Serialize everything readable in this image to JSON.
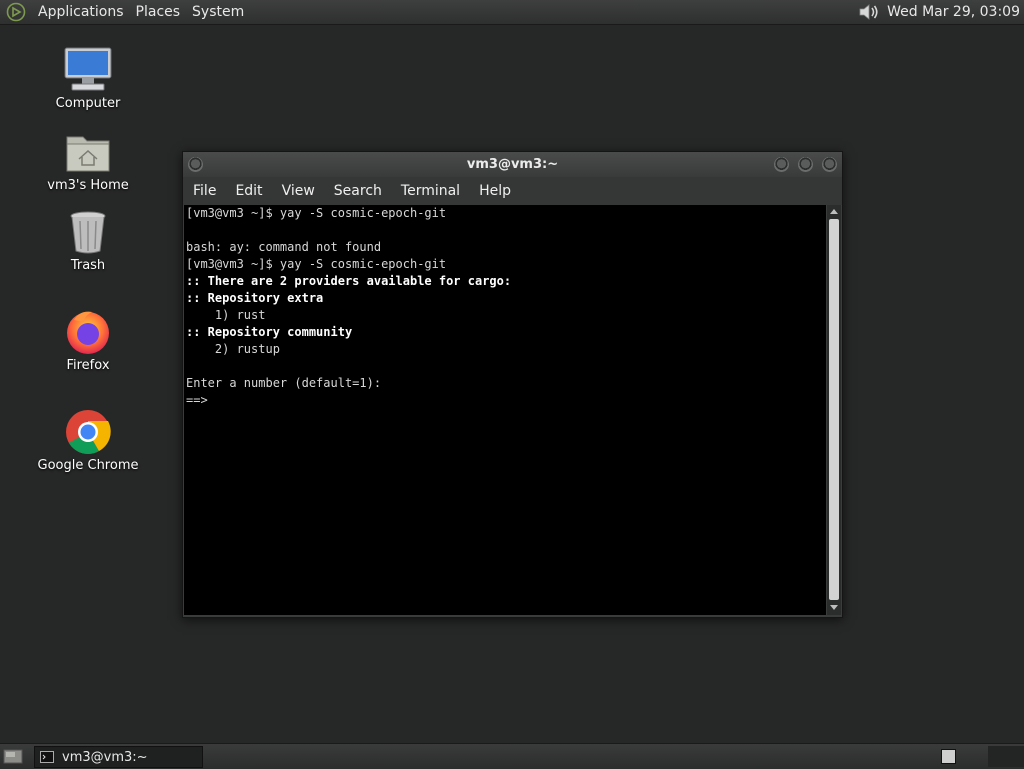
{
  "top_panel": {
    "menus": [
      "Applications",
      "Places",
      "System"
    ],
    "clock": "Wed Mar 29, 03:09",
    "icons": {
      "logo": "distro-logo-icon",
      "volume": "volume-icon"
    }
  },
  "desktop_icons": [
    {
      "label": "Computer",
      "icon": "computer-icon"
    },
    {
      "label": "vm3's Home",
      "icon": "home-folder-icon"
    },
    {
      "label": "Trash",
      "icon": "trash-icon"
    },
    {
      "label": "Firefox",
      "icon": "firefox-icon"
    },
    {
      "label": "Google Chrome",
      "icon": "chrome-icon"
    }
  ],
  "window": {
    "title": "vm3@vm3:~",
    "menus": [
      "File",
      "Edit",
      "View",
      "Search",
      "Terminal",
      "Help"
    ],
    "terminal_lines": [
      {
        "text": "[vm3@vm3 ~]$ yay -S cosmic-epoch-git",
        "bold": false
      },
      {
        "text": "",
        "bold": false
      },
      {
        "text": "bash: ay: command not found",
        "bold": false
      },
      {
        "text": "[vm3@vm3 ~]$ yay -S cosmic-epoch-git",
        "bold": false
      },
      {
        "text": ":: There are 2 providers available for cargo:",
        "bold": true
      },
      {
        "text": ":: Repository extra",
        "bold": true
      },
      {
        "text": "    1) rust",
        "bold": false
      },
      {
        "text": ":: Repository community",
        "bold": true
      },
      {
        "text": "    2) rustup",
        "bold": false
      },
      {
        "text": "",
        "bold": false
      },
      {
        "text": "Enter a number (default=1):",
        "bold": false
      },
      {
        "text": "==>",
        "bold": false
      }
    ]
  },
  "bottom_panel": {
    "task_label": "vm3@vm3:~"
  },
  "colors": {
    "desktop_bg": "#262727",
    "terminal_bg": "#000000",
    "terminal_fg": "#d8d8d8"
  }
}
